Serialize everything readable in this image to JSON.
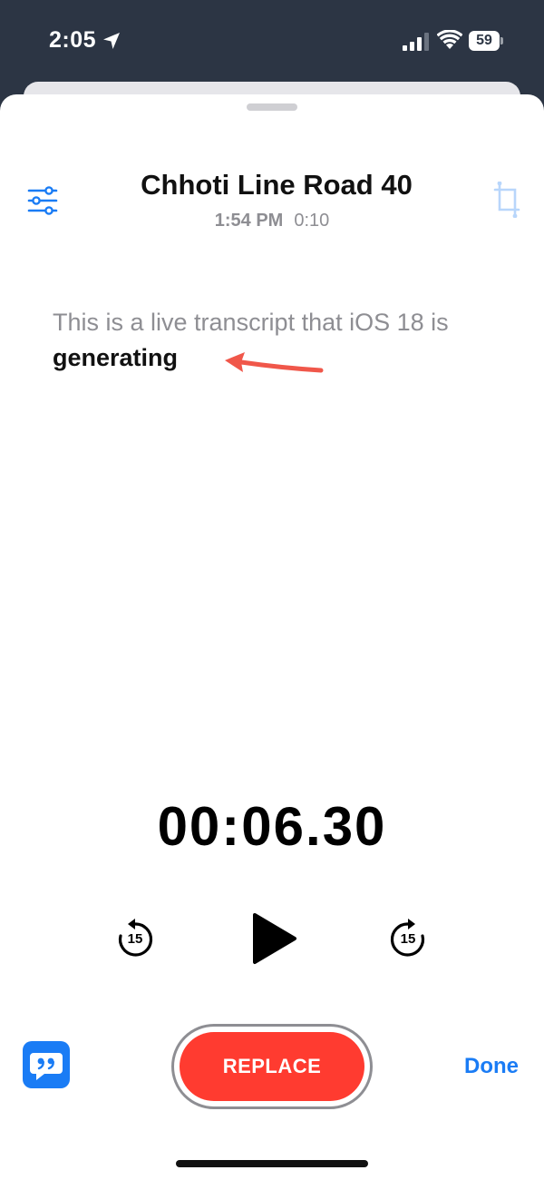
{
  "status_bar": {
    "time": "2:05",
    "battery": "59",
    "icons": [
      "location-icon",
      "signal-icon",
      "wifi-icon",
      "battery-icon"
    ]
  },
  "recording": {
    "title": "Chhoti Line Road 40",
    "recorded_at": "1:54 PM",
    "duration": "0:10"
  },
  "transcript": {
    "text": "This is a live transcript that iOS 18 is ",
    "current_word": "generating"
  },
  "player": {
    "elapsed": "00:06.30",
    "skip_back_label": "15",
    "skip_forward_label": "15",
    "icons": [
      "skip-back-15-icon",
      "play-icon",
      "skip-forward-15-icon"
    ]
  },
  "bottom_bar": {
    "replace_label": "REPLACE",
    "done_label": "Done",
    "icons": [
      "transcript-quote-icon"
    ]
  },
  "colors": {
    "accent_blue": "#1a7cf5",
    "record_red": "#ff3b30",
    "secondary_gray": "#8e8e93",
    "annotation_red": "#f0574a",
    "status_bar_bg": "#2c3544"
  }
}
